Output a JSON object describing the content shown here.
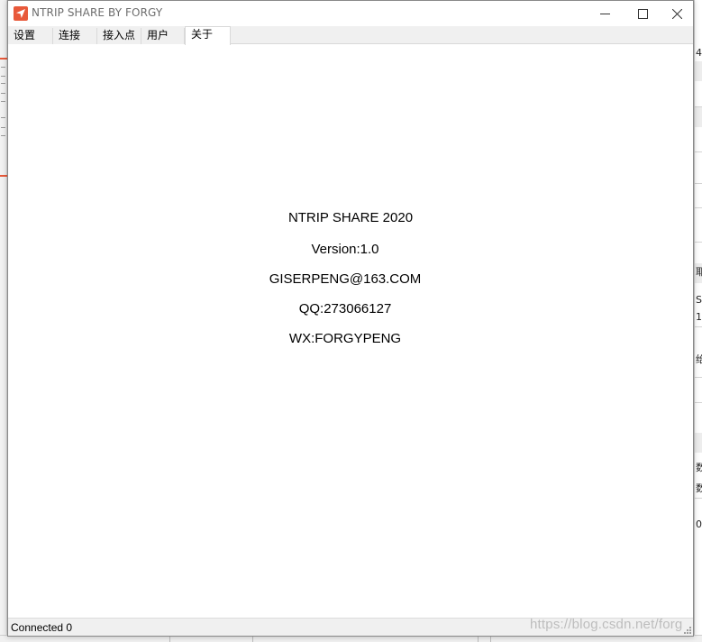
{
  "window": {
    "title": "NTRIP SHARE BY FORGY",
    "icon": "location-arrow-icon",
    "accent": "#e8593a"
  },
  "tabs": [
    {
      "label": "设置",
      "active": false
    },
    {
      "label": "连接",
      "active": false
    },
    {
      "label": "接入点",
      "active": false
    },
    {
      "label": "用户",
      "active": false
    },
    {
      "label": "关于",
      "active": true
    }
  ],
  "about": {
    "product": "NTRIP SHARE 2020",
    "version": "Version:1.0",
    "email": "GISERPENG@163.COM",
    "qq": "QQ:273066127",
    "wx": "WX:FORGYPENG"
  },
  "status": {
    "text": "Connected 0"
  },
  "watermark": "https://blog.csdn.net/forg",
  "background_app": {
    "right_glyphs": [
      "4",
      "耶",
      "S",
      "1",
      "绐",
      "数",
      "数",
      "0"
    ]
  }
}
